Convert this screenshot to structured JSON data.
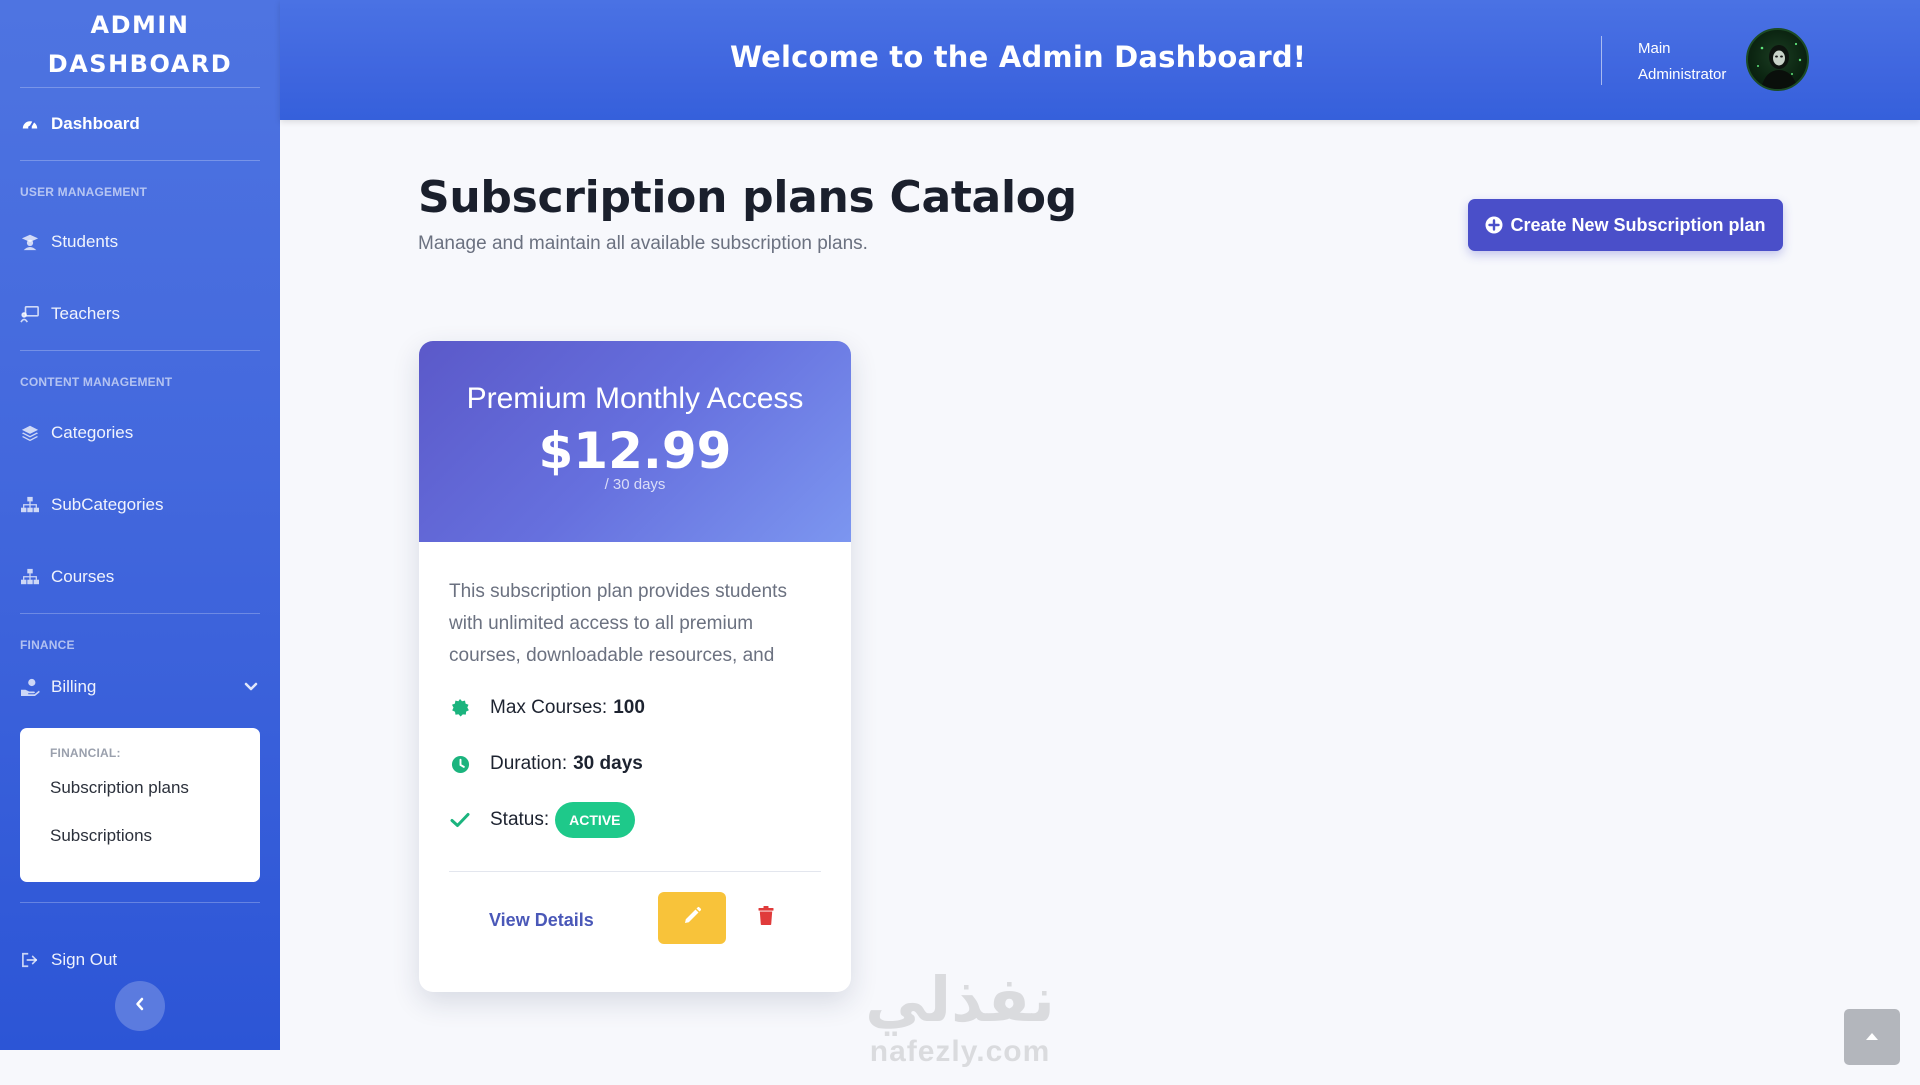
{
  "sidebar": {
    "brand_line1": "ADMIN",
    "brand_line2": "DASHBOARD",
    "dashboard_label": "Dashboard",
    "section_user": "USER MANAGEMENT",
    "students_label": "Students",
    "teachers_label": "Teachers",
    "section_content": "CONTENT MANAGEMENT",
    "categories_label": "Categories",
    "subcategories_label": "SubCategories",
    "courses_label": "Courses",
    "section_finance": "FINANCE",
    "billing_label": "Billing",
    "submenu": {
      "label": "FINANCIAL:",
      "items": [
        "Subscription plans",
        "Subscriptions"
      ]
    },
    "signout_label": "Sign Out"
  },
  "header": {
    "welcome": "Welcome to the Admin Dashboard!",
    "admin_line1": "Main",
    "admin_line2": "Administrator"
  },
  "main": {
    "title": "Subscription plans Catalog",
    "subtitle": "Manage and maintain all available subscription plans.",
    "create_button": "Create New Subscription plan"
  },
  "plan_card": {
    "name": "Premium Monthly Access",
    "price": "$12.99",
    "period": "/ 30 days",
    "description": "This subscription plan provides students with unlimited access to all premium courses, downloadable resources, and",
    "max_courses_label": "Max Courses:",
    "max_courses_value": "100",
    "duration_label": "Duration:",
    "duration_value": "30 days",
    "status_label": "Status:",
    "status_value": "ACTIVE",
    "view_details": "View Details"
  },
  "watermark": {
    "arabic": "نفذلي",
    "latin": "nafezly.com"
  },
  "colors": {
    "sidebar": "#4368dd",
    "header": "#3f66df",
    "create_button": "#4a4fc9",
    "status_active": "#1ec98a",
    "edit_button": "#f8c33a",
    "delete_icon": "#e03b3b"
  },
  "icons": {
    "dashboard": "gauge-icon",
    "students": "user-graduate-icon",
    "teachers": "chalkboard-teacher-icon",
    "categories": "layers-icon",
    "subcategories": "sitemap-icon",
    "courses": "sitemap-icon",
    "billing": "hand-holding-dollar-icon",
    "signout": "sign-out-icon",
    "create": "plus-circle-icon",
    "max_courses": "badge-certificate-icon",
    "duration": "clock-icon",
    "status": "check-icon",
    "edit": "pencil-icon",
    "delete": "trash-icon",
    "scroll_top": "caret-up-icon",
    "collapse": "chevron-left-icon"
  }
}
